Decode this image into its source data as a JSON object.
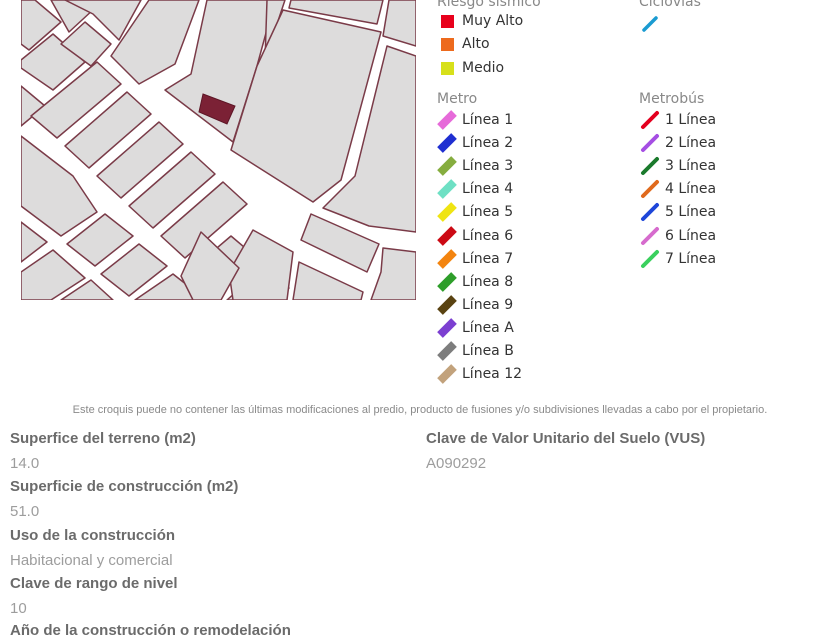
{
  "legend": {
    "riesgo": {
      "title": "Riesgo sísmico",
      "items": [
        {
          "label": "Muy Alto",
          "color": "#e8001c"
        },
        {
          "label": "Alto",
          "color": "#ed6a1d"
        },
        {
          "label": "Medio",
          "color": "#d7e01a"
        }
      ]
    },
    "ciclovias": {
      "title": "Ciclovías",
      "items": [
        {
          "label": "",
          "color": "#1a9bd1"
        }
      ]
    },
    "metro": {
      "title": "Metro",
      "items": [
        {
          "label": "Línea 1",
          "color": "#e66ad9"
        },
        {
          "label": "Línea 2",
          "color": "#1f2fd1"
        },
        {
          "label": "Línea 3",
          "color": "#86ad3f"
        },
        {
          "label": "Línea 4",
          "color": "#6ee0c4"
        },
        {
          "label": "Línea 5",
          "color": "#efe412"
        },
        {
          "label": "Línea 6",
          "color": "#cc0a14"
        },
        {
          "label": "Línea 7",
          "color": "#f3840f"
        },
        {
          "label": "Línea 8",
          "color": "#2e9e2a"
        },
        {
          "label": "Línea 9",
          "color": "#5a4312"
        },
        {
          "label": "Línea A",
          "color": "#7c3fd1"
        },
        {
          "label": "Línea B",
          "color": "#7d7d7d"
        },
        {
          "label": "Línea 12",
          "color": "#c2a27c"
        }
      ]
    },
    "metrobus": {
      "title": "Metrobús",
      "items": [
        {
          "label": "1 Línea",
          "color": "#e4001f"
        },
        {
          "label": "2 Línea",
          "color": "#a54ee3"
        },
        {
          "label": "3 Línea",
          "color": "#1a7a2c"
        },
        {
          "label": "4 Línea",
          "color": "#e06a1d"
        },
        {
          "label": "5 Línea",
          "color": "#1e46d9"
        },
        {
          "label": "6 Línea",
          "color": "#d66bcd"
        },
        {
          "label": "7 Línea",
          "color": "#3ad05e"
        }
      ]
    }
  },
  "disclaimer": "Este croquis puede no contener las últimas modificaciones al predio, producto de fusiones y/o subdivisiones llevadas a cabo por el propietario.",
  "fields": [
    {
      "label": "Superfice del terreno (m2)",
      "value": "14.0"
    },
    {
      "label": "Superficie de construcción (m2)",
      "value": "51.0"
    },
    {
      "label": "Uso de la construcción",
      "value": "Habitacional y comercial"
    },
    {
      "label": "Clave de rango de nivel",
      "value": "10"
    },
    {
      "label": "Año de la construcción o remodelación",
      "value": ""
    },
    {
      "label": "Clave de Valor Unitario del Suelo (VUS)",
      "value": "A090292"
    }
  ],
  "colors": {
    "block_fill": "#dddcdc",
    "block_stroke": "#7a3b48",
    "highlight_parcel": "#7b2135"
  }
}
